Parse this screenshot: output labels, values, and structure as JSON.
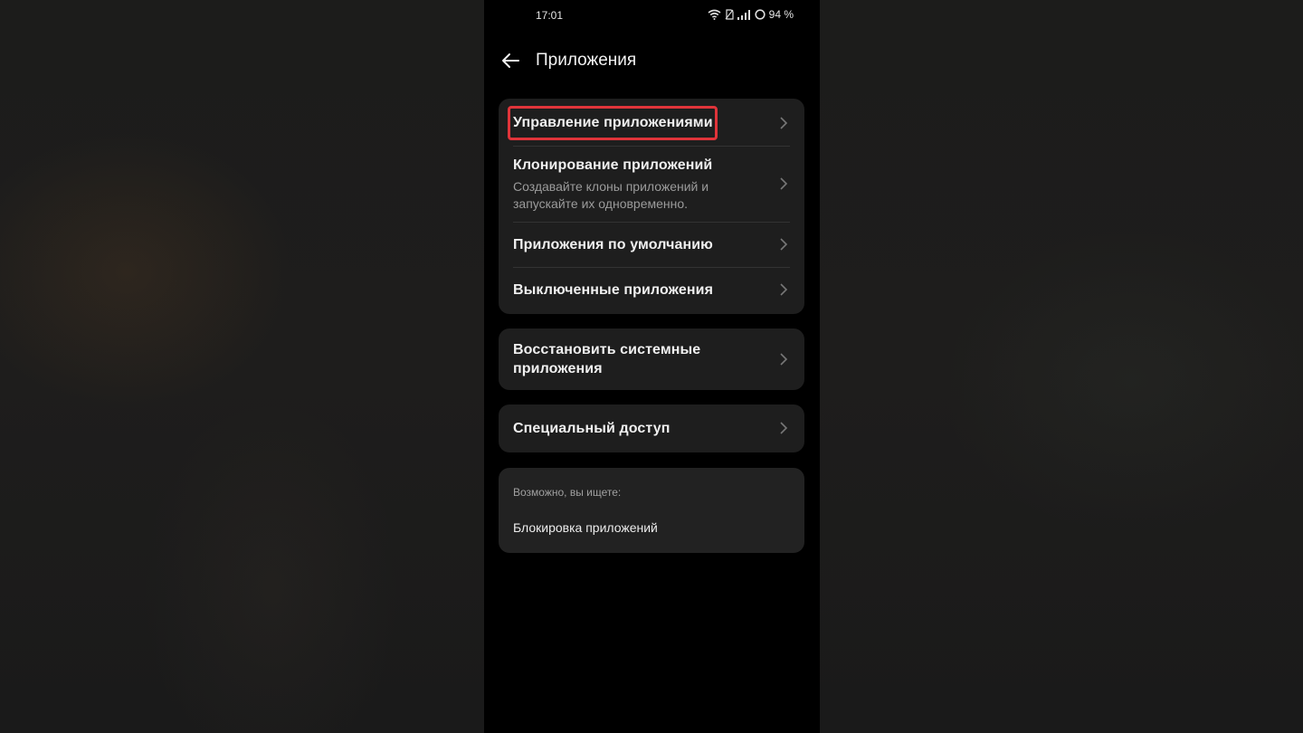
{
  "status_bar": {
    "time": "17:01",
    "battery": "94 %",
    "icons": [
      "wifi-icon",
      "sim-icon",
      "signal-icon",
      "battery-icon"
    ]
  },
  "header": {
    "back_icon": "arrow-left-icon",
    "title": "Приложения"
  },
  "group1": {
    "items": [
      {
        "label": "Управление приложениями",
        "highlighted": true
      },
      {
        "label": "Клонирование приложений",
        "sub_line1": "Создавайте клоны приложений и",
        "sub_line2": "запускайте их одновременно."
      },
      {
        "label": "Приложения по умолчанию"
      },
      {
        "label": "Выключенные приложения"
      }
    ]
  },
  "group2": {
    "label_line1": "Восстановить системные",
    "label_line2": "приложения"
  },
  "group3": {
    "label": "Специальный доступ"
  },
  "suggestions": {
    "title": "Возможно, вы ищете:",
    "item": "Блокировка приложений"
  },
  "colors": {
    "highlight": "#e0343a",
    "card": "#1e1e1e",
    "screen": "#000000"
  }
}
